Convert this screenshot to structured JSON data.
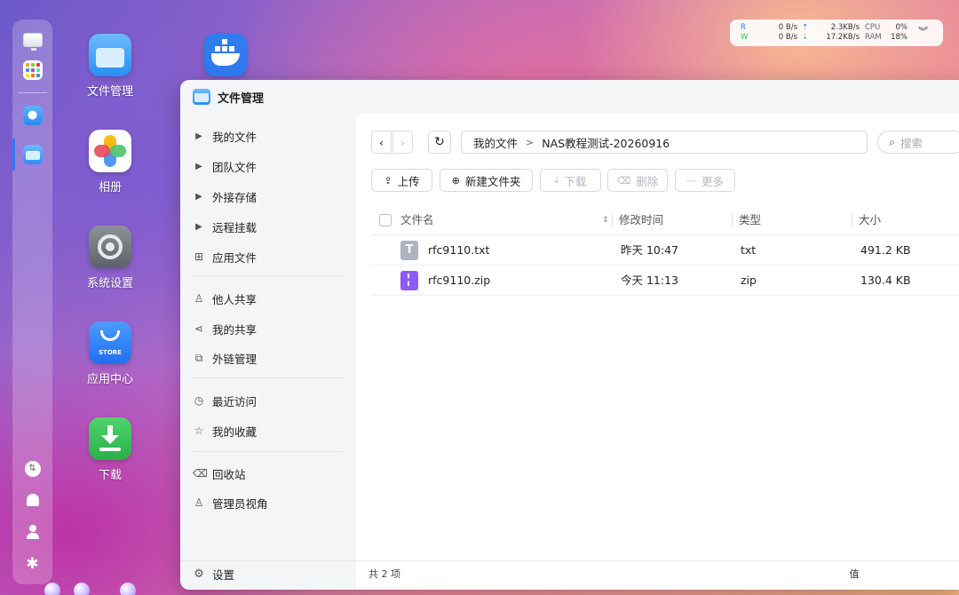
{
  "desktop": {
    "icons": [
      {
        "label": "文件管理",
        "icon": "file-manager-icon"
      },
      {
        "label": "相册",
        "icon": "photos-icon"
      },
      {
        "label": "系统设置",
        "icon": "settings-gear-icon"
      },
      {
        "label": "应用中心",
        "icon": "app-store-icon",
        "badge": "STORE"
      },
      {
        "label": "下载",
        "icon": "download-icon"
      },
      {
        "label": "",
        "icon": "docker-icon"
      }
    ]
  },
  "status": {
    "r_label": "R",
    "w_label": "W",
    "r_disk": "0 B/s",
    "w_disk": "0 B/s",
    "up_net": "2.3KB/s",
    "down_net": "17.2KB/s",
    "cpu_label": "CPU",
    "cpu": "0%",
    "ram_label": "RAM",
    "ram": "18%"
  },
  "window": {
    "title": "文件管理",
    "sidebar": {
      "items": [
        {
          "label": "我的文件",
          "icon": "caret-right-icon"
        },
        {
          "label": "团队文件",
          "icon": "caret-right-icon"
        },
        {
          "label": "外接存储",
          "icon": "caret-right-icon"
        },
        {
          "label": "远程挂载",
          "icon": "caret-right-icon"
        },
        {
          "label": "应用文件",
          "icon": "grid-icon"
        },
        {
          "label": "他人共享",
          "icon": "users-icon"
        },
        {
          "label": "我的共享",
          "icon": "share-icon"
        },
        {
          "label": "外链管理",
          "icon": "external-link-icon"
        },
        {
          "label": "最近访问",
          "icon": "clock-icon"
        },
        {
          "label": "我的收藏",
          "icon": "star-icon"
        },
        {
          "label": "回收站",
          "icon": "trash-icon"
        },
        {
          "label": "管理员视角",
          "icon": "admin-user-icon"
        }
      ],
      "settings_label": "设置"
    },
    "path": {
      "root": "我的文件",
      "separator": ">",
      "current": "NAS教程测试-20260916"
    },
    "search_placeholder": "搜索",
    "toolbar": {
      "upload": "上传",
      "new_folder": "新建文件夹",
      "download": "下载",
      "delete": "删除",
      "more": "更多"
    },
    "table": {
      "headers": {
        "name": "文件名",
        "modified": "修改时间",
        "type": "类型",
        "size": "大小"
      },
      "rows": [
        {
          "name": "rfc9110.txt",
          "modified": "昨天 10:47",
          "type": "txt",
          "size": "491.2 KB",
          "icon": "text-file-icon"
        },
        {
          "name": "rfc9110.zip",
          "modified": "今天 11:13",
          "type": "zip",
          "size": "130.4 KB",
          "icon": "zip-file-icon"
        }
      ]
    },
    "footer": "共 2 项"
  },
  "watermark": "什么值得买",
  "colors": {
    "accent": "#2f7bf6",
    "zip": "#8b5cf6",
    "txt": "#aeb4bf",
    "download_green": "#36c15a"
  }
}
